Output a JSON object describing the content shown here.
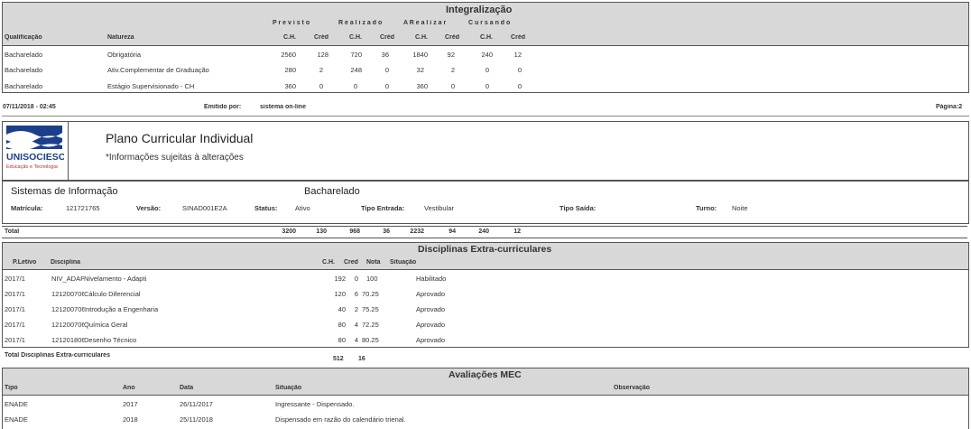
{
  "integ": {
    "title": "Integralização",
    "groups": [
      "P r e v i s t o",
      "R e a l i z a d o",
      "A R e a l i z a r",
      "C u r s a n d o"
    ],
    "col_qualif": "Qualificação",
    "col_natureza": "Natureza",
    "sub": [
      "C.H.",
      "Créd",
      "C.H.",
      "Créd",
      "C.H.",
      "Créd",
      "C.H.",
      "Créd"
    ],
    "rows": [
      {
        "q": "Bacharelado",
        "n": "Obrigatória",
        "v": [
          "2560",
          "128",
          "720",
          "36",
          "1840",
          "92",
          "240",
          "12"
        ]
      },
      {
        "q": "Bacharelado",
        "n": "Ativ.Complementar de Graduação",
        "v": [
          "280",
          "2",
          "248",
          "0",
          "32",
          "2",
          "0",
          "0"
        ]
      },
      {
        "q": "Bacharelado",
        "n": "Estágio Supervisionado - CH",
        "v": [
          "360",
          "0",
          "0",
          "0",
          "360",
          "0",
          "0",
          "0"
        ]
      }
    ]
  },
  "footer": {
    "datetime": "07/11/2018 - 02:45",
    "emitido_label": "Emitido por:",
    "emitido_value": "sistema on-line",
    "page": "Página:2"
  },
  "header": {
    "logo_text": "UNISOCIESC",
    "logo_sub": "Educação e Tecnologia",
    "title": "Plano Curricular Individual",
    "subtitle": "*Informações sujeitas à alterações"
  },
  "student": {
    "course": "Sistemas de Informação",
    "degree": "Bacharelado",
    "matricula_label": "Matrícula:",
    "matricula": "121721765",
    "versao_label": "Versão:",
    "versao": "SINAD001E2A",
    "status_label": "Status:",
    "status": "Ativo",
    "entrada_label": "Tipo Entrada:",
    "entrada": "Vestibular",
    "saida_label": "Tipo Saída:",
    "turno_label": "Turno:",
    "turno": "Noite"
  },
  "total": {
    "label": "Total",
    "values": [
      "3200",
      "130",
      "968",
      "36",
      "2232",
      "94",
      "240",
      "12"
    ]
  },
  "extra": {
    "title": "Disciplinas Extra-curriculares",
    "h_periodo": "P.Letivo",
    "h_disc": "Disciplina",
    "h_ch": "C.H.",
    "h_cred": "Cred",
    "h_nota": "Nota",
    "h_sit": "Situação",
    "rows": [
      {
        "p": "2017/1",
        "code": "NIV_ADAP",
        "d": "Nivelamento - Adapti",
        "ch": "192",
        "cr": "0",
        "nota": "100",
        "s": "Habilitado"
      },
      {
        "p": "2017/1",
        "code": "121200706",
        "d": "Cálculo Diferencial",
        "ch": "120",
        "cr": "6",
        "nota": "70.25",
        "s": "Aprovado"
      },
      {
        "p": "2017/1",
        "code": "121200706",
        "d": "Introdução a Engenharia",
        "ch": "40",
        "cr": "2",
        "nota": "75.25",
        "s": "Aprovado"
      },
      {
        "p": "2017/1",
        "code": "121200706",
        "d": "Química Geral",
        "ch": "80",
        "cr": "4",
        "nota": "72.25",
        "s": "Aprovado"
      },
      {
        "p": "2017/1",
        "code": "121201806",
        "d": "Desenho Técnico",
        "ch": "80",
        "cr": "4",
        "nota": "80.25",
        "s": "Aprovado"
      }
    ],
    "total_label": "Total Disciplinas Extra-curriculares",
    "total_ch": "512",
    "total_cr": "16"
  },
  "mec": {
    "title": "Avaliações MEC",
    "h_tipo": "Tipo",
    "h_ano": "Ano",
    "h_data": "Data",
    "h_sit": "Situação",
    "h_obs": "Observação",
    "rows": [
      {
        "tipo": "ENADE",
        "ano": "2017",
        "data": "26/11/2017",
        "sit": "Ingressante - Dispensado."
      },
      {
        "tipo": "ENADE",
        "ano": "2018",
        "data": "25/11/2018",
        "sit": "Dispensado em razão do calendário trienal."
      }
    ]
  }
}
